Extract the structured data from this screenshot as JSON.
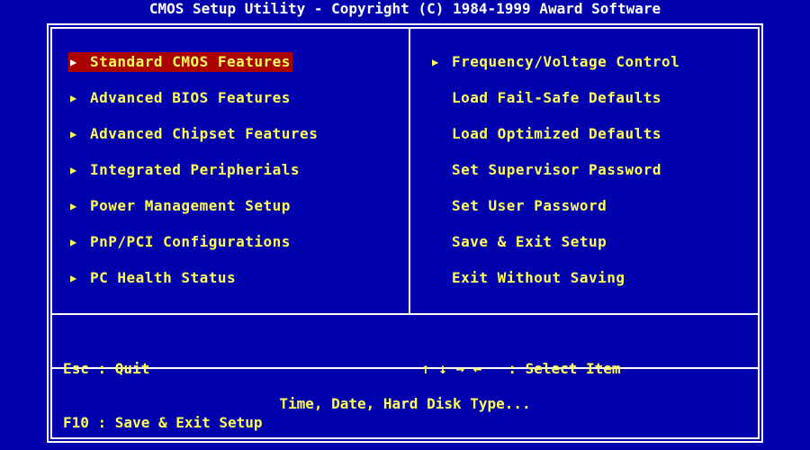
{
  "header": {
    "title": "CMOS Setup Utility - Copyright (C) 1984-1999 Award Software"
  },
  "menu": {
    "left": [
      {
        "label": "Standard CMOS Features",
        "selected": true,
        "arrow": true
      },
      {
        "label": "Advanced BIOS Features",
        "selected": false,
        "arrow": true
      },
      {
        "label": "Advanced Chipset Features",
        "selected": false,
        "arrow": true
      },
      {
        "label": "Integrated Peripherials",
        "selected": false,
        "arrow": true
      },
      {
        "label": "Power Management Setup",
        "selected": false,
        "arrow": true
      },
      {
        "label": "PnP/PCI Configurations",
        "selected": false,
        "arrow": true
      },
      {
        "label": "PC Health Status",
        "selected": false,
        "arrow": true
      }
    ],
    "right": [
      {
        "label": "Frequency/Voltage Control",
        "selected": false,
        "arrow": true
      },
      {
        "label": "Load Fail-Safe Defaults",
        "selected": false,
        "arrow": false
      },
      {
        "label": "Load Optimized Defaults",
        "selected": false,
        "arrow": false
      },
      {
        "label": "Set Supervisor Password",
        "selected": false,
        "arrow": false
      },
      {
        "label": "Set User Password",
        "selected": false,
        "arrow": false
      },
      {
        "label": "Save & Exit Setup",
        "selected": false,
        "arrow": false
      },
      {
        "label": "Exit Without Saving",
        "selected": false,
        "arrow": false
      }
    ],
    "arrow_glyph": "▶"
  },
  "help": {
    "esc_line": "Esc : Quit",
    "f10_line": "F10 : Save & Exit Setup",
    "select_line": "↑ ↓ → ←   : Select Item"
  },
  "status": {
    "text": "Time, Date, Hard Disk Type..."
  },
  "colors": {
    "background": "#0000ac",
    "text": "#ffff54",
    "border": "#ffffff",
    "highlight": "#aa0000"
  }
}
